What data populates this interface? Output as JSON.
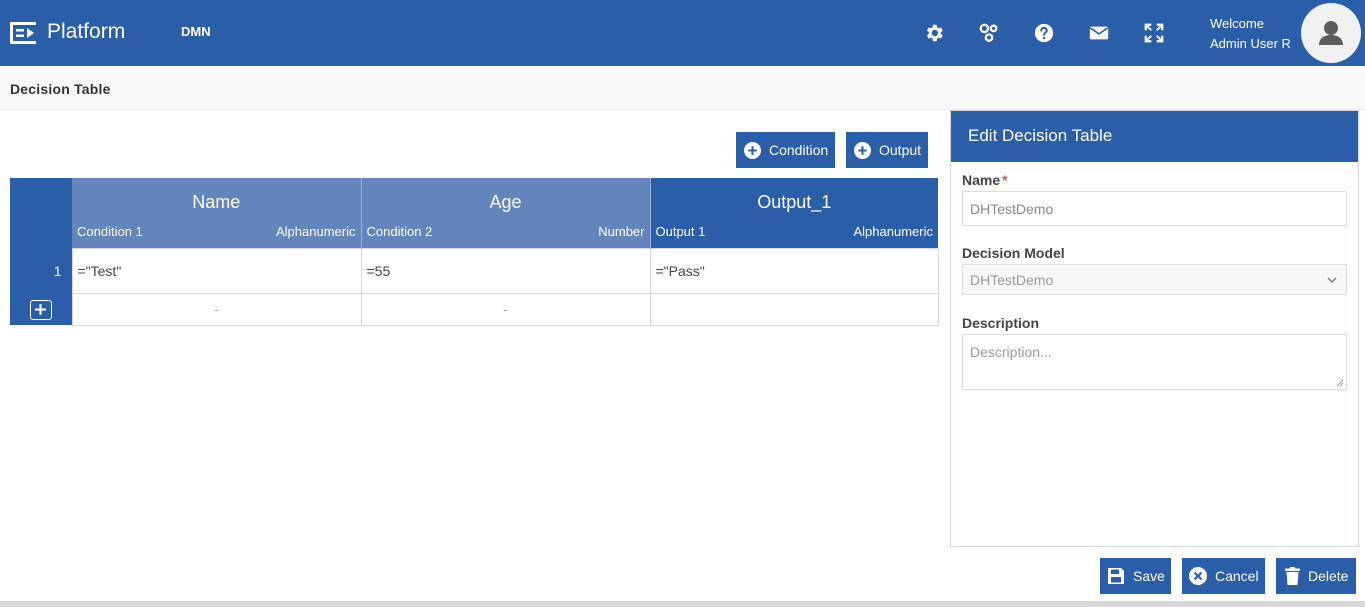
{
  "header": {
    "brand": "Platform",
    "module": "DMN",
    "welcome_line1": "Welcome",
    "welcome_line2": "Admin User R",
    "icons": [
      "gear-icon",
      "cluster-icon",
      "help-icon",
      "mail-icon",
      "fullscreen-icon",
      "user-avatar-icon"
    ]
  },
  "breadcrumb": {
    "title": "Decision Table"
  },
  "toolbar": {
    "condition_label": "Condition",
    "output_label": "Output"
  },
  "table": {
    "columns": [
      {
        "name": "Name",
        "sub": "Condition 1",
        "type": "Alphanumeric"
      },
      {
        "name": "Age",
        "sub": "Condition 2",
        "type": "Number"
      },
      {
        "name": "Output_1",
        "sub": "Output 1",
        "type": "Alphanumeric"
      }
    ],
    "rows": [
      {
        "num": "1",
        "cells": [
          "=\"Test\"",
          "=55",
          "=\"Pass\""
        ]
      }
    ],
    "add_row": [
      "-",
      "-",
      ""
    ]
  },
  "panel": {
    "title": "Edit Decision Table",
    "name_label": "Name",
    "required_mark": "*",
    "name_value": "DHTestDemo",
    "model_label": "Decision Model",
    "model_value": "DHTestDemo",
    "description_label": "Description",
    "description_placeholder": "Description..."
  },
  "actions": {
    "save_label": "Save",
    "cancel_label": "Cancel",
    "delete_label": "Delete"
  },
  "colors": {
    "primary": "#2a5ea8",
    "condition_header": "#6484bc",
    "required": "#d9534f"
  }
}
